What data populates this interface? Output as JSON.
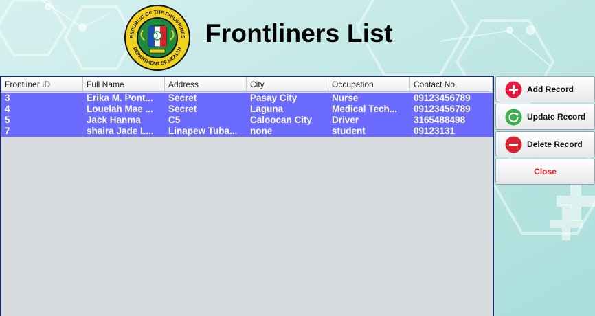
{
  "header": {
    "seal_text_top": "REPUBLIC OF THE PHILIPPINES",
    "seal_text_bottom": "DEPARTMENT OF HEALTH",
    "title": "Frontliners List"
  },
  "table": {
    "columns": [
      "Frontliner ID",
      "Full Name",
      "Address",
      "City",
      "Occupation",
      "Contact No."
    ],
    "rows": [
      [
        "3",
        "Erika M. Pont...",
        "Secret",
        "Pasay City",
        "Nurse",
        "09123456789"
      ],
      [
        "4",
        "Louelah Mae ...",
        "Secret",
        "Laguna",
        "Medical Tech...",
        "09123456789"
      ],
      [
        "5",
        "Jack Hanma",
        "C5",
        "Caloocan City",
        "Driver",
        "3165488498"
      ],
      [
        "7",
        "shaira Jade L...",
        "Linapew Tuba...",
        "none",
        "student",
        "09123131"
      ]
    ]
  },
  "actions": {
    "add_label": "Add Record",
    "update_label": "Update Record",
    "delete_label": "Delete Record",
    "close_label": "Close"
  },
  "colors": {
    "selected_row": "#6b6bff",
    "table_border": "#1c2d63",
    "add_icon": "#e8173b",
    "update_icon": "#3cae4a",
    "delete_icon": "#d7232e",
    "close_text": "#e8101a"
  },
  "icons": {
    "add": "plus-circle-icon",
    "update": "refresh-circle-icon",
    "delete": "minus-circle-icon"
  }
}
